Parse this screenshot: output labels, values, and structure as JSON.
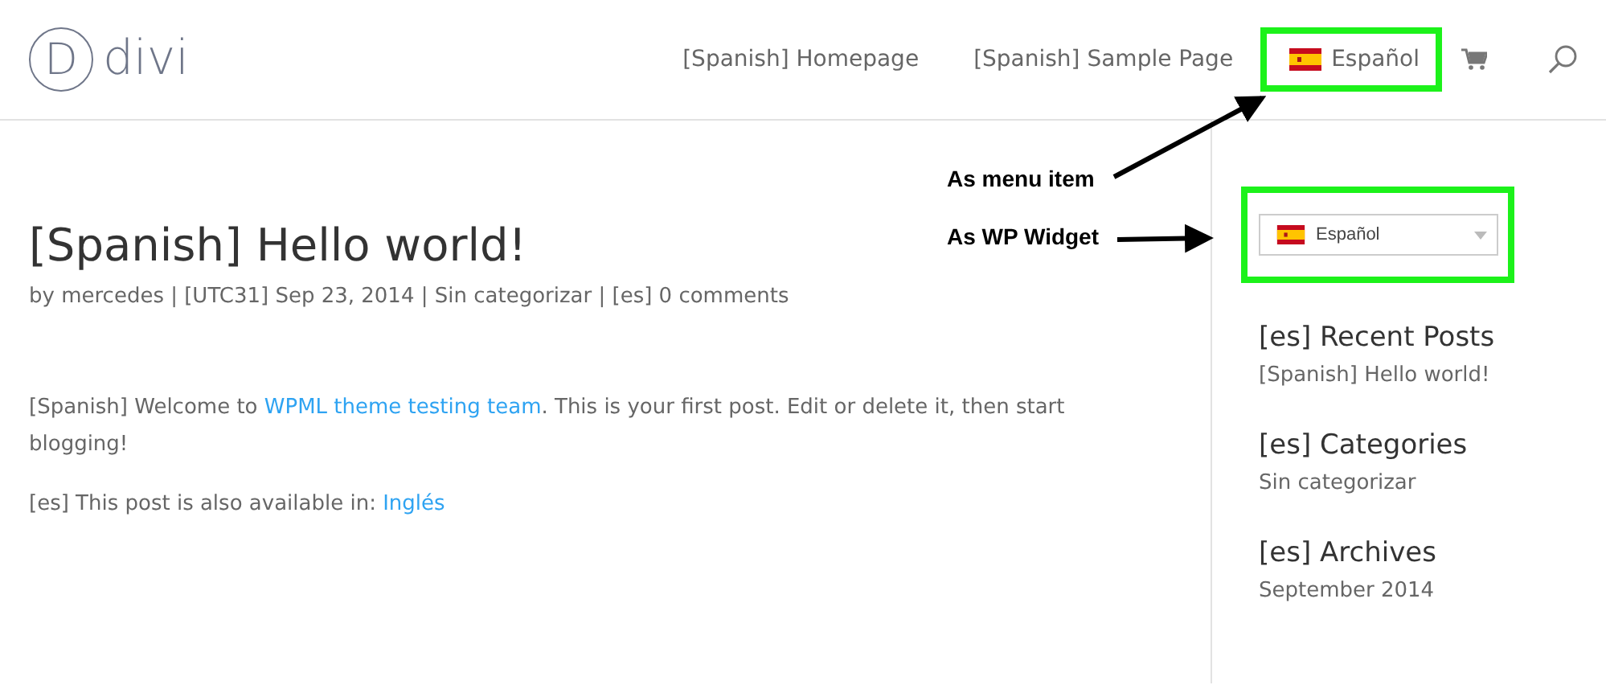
{
  "header": {
    "logo": {
      "letter": "D",
      "text": "divi"
    },
    "nav": [
      {
        "kind": "link",
        "label": "[Spanish] Homepage",
        "highlighted": false
      },
      {
        "kind": "link",
        "label": "[Spanish] Sample Page",
        "highlighted": false
      },
      {
        "kind": "language",
        "label": "Español",
        "highlighted": true
      },
      {
        "kind": "cart"
      },
      {
        "kind": "search"
      }
    ]
  },
  "post": {
    "title": "[Spanish] Hello world!",
    "meta": "by mercedes | [UTC31] Sep 23, 2014 | Sin categorizar | [es] 0 comments",
    "paragraphs": [
      [
        {
          "text": "[Spanish] Welcome to ",
          "link": false
        },
        {
          "text": "WPML theme testing team",
          "link": true
        },
        {
          "text": ". This is your first post. Edit or delete it, then start blogging!",
          "link": false
        }
      ],
      [
        {
          "text": "[es] This post is also available in: ",
          "link": false
        },
        {
          "text": "Inglés",
          "link": true
        }
      ]
    ]
  },
  "sidebar": {
    "language_widget": {
      "value": "Español",
      "highlighted": true
    },
    "widgets": [
      {
        "title": "[es] Recent Posts",
        "items": [
          "[Spanish] Hello world!"
        ]
      },
      {
        "title": "[es] Categories",
        "items": [
          "Sin categorizar"
        ]
      },
      {
        "title": "[es] Archives",
        "items": [
          "September 2014"
        ]
      }
    ]
  },
  "annotations": [
    {
      "text": "As menu item"
    },
    {
      "text": "As WP Widget"
    }
  ]
}
